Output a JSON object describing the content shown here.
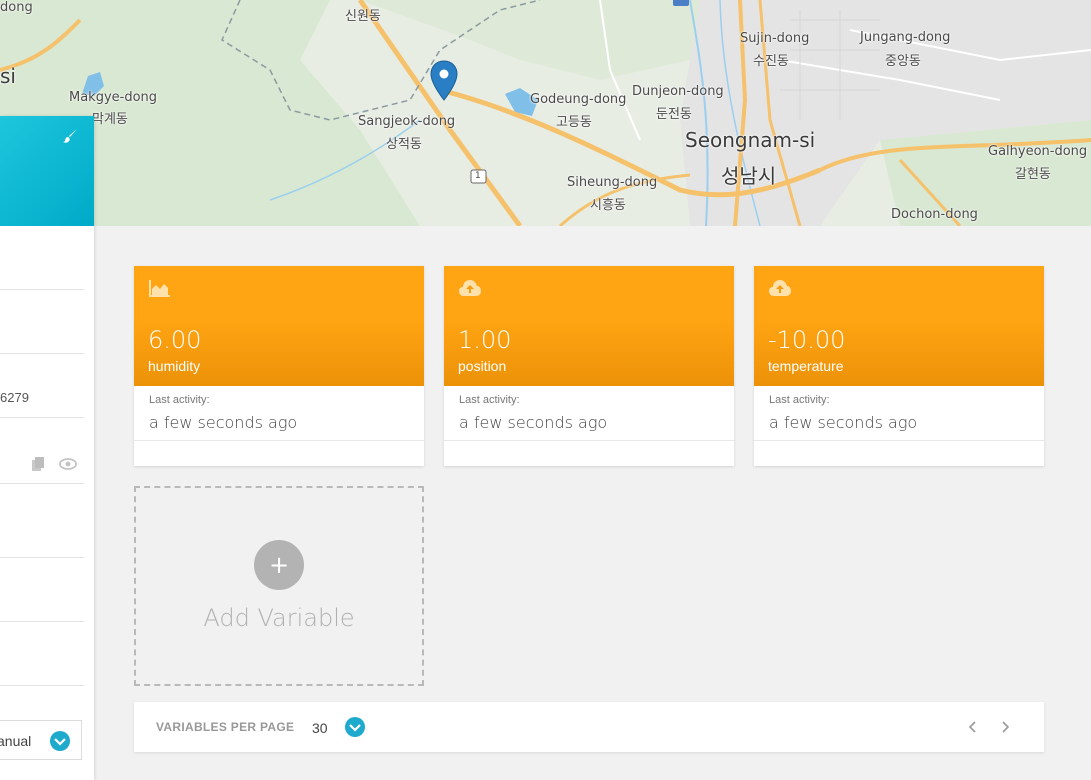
{
  "map": {
    "labels": [
      {
        "text": "dong"
      },
      {
        "text": "si"
      },
      {
        "text": "Makgye-dong"
      },
      {
        "text": "막계동"
      },
      {
        "text": "신원동"
      },
      {
        "text": "Sangjeok-dong"
      },
      {
        "text": "상적동"
      },
      {
        "text": "Godeung-dong"
      },
      {
        "text": "고등동"
      },
      {
        "text": "Dunjeon-dong"
      },
      {
        "text": "둔전동"
      },
      {
        "text": "Sujin-dong"
      },
      {
        "text": "수진동"
      },
      {
        "text": "Jungang-dong"
      },
      {
        "text": "중앙동"
      },
      {
        "text": "Seongnam-si"
      },
      {
        "text": "성남시"
      },
      {
        "text": "Siheung-dong"
      },
      {
        "text": "시흥동"
      },
      {
        "text": "Galhyeon-dong"
      },
      {
        "text": "갈현동"
      },
      {
        "text": "Dochon-dong"
      },
      {
        "text": "1"
      }
    ]
  },
  "left_panel": {
    "partial_id": "6279",
    "mode_value": "anual"
  },
  "cards": [
    {
      "icon": "area-chart-icon",
      "value": "6.00",
      "name": "humidity",
      "last_activity_label": "Last activity:",
      "last_activity_value": "a few seconds ago"
    },
    {
      "icon": "cloud-upload-icon",
      "value": "1.00",
      "name": "position",
      "last_activity_label": "Last activity:",
      "last_activity_value": "a few seconds ago"
    },
    {
      "icon": "cloud-upload-icon",
      "value": "-10.00",
      "name": "temperature",
      "last_activity_label": "Last activity:",
      "last_activity_value": "a few seconds ago"
    }
  ],
  "add_variable": {
    "plus": "+",
    "label": "Add Variable"
  },
  "pager": {
    "label": "VARIABLES PER PAGE",
    "count": "30"
  },
  "colors": {
    "accent": "#1eaacd",
    "card": "#ffa412",
    "header": "#00aac8"
  }
}
